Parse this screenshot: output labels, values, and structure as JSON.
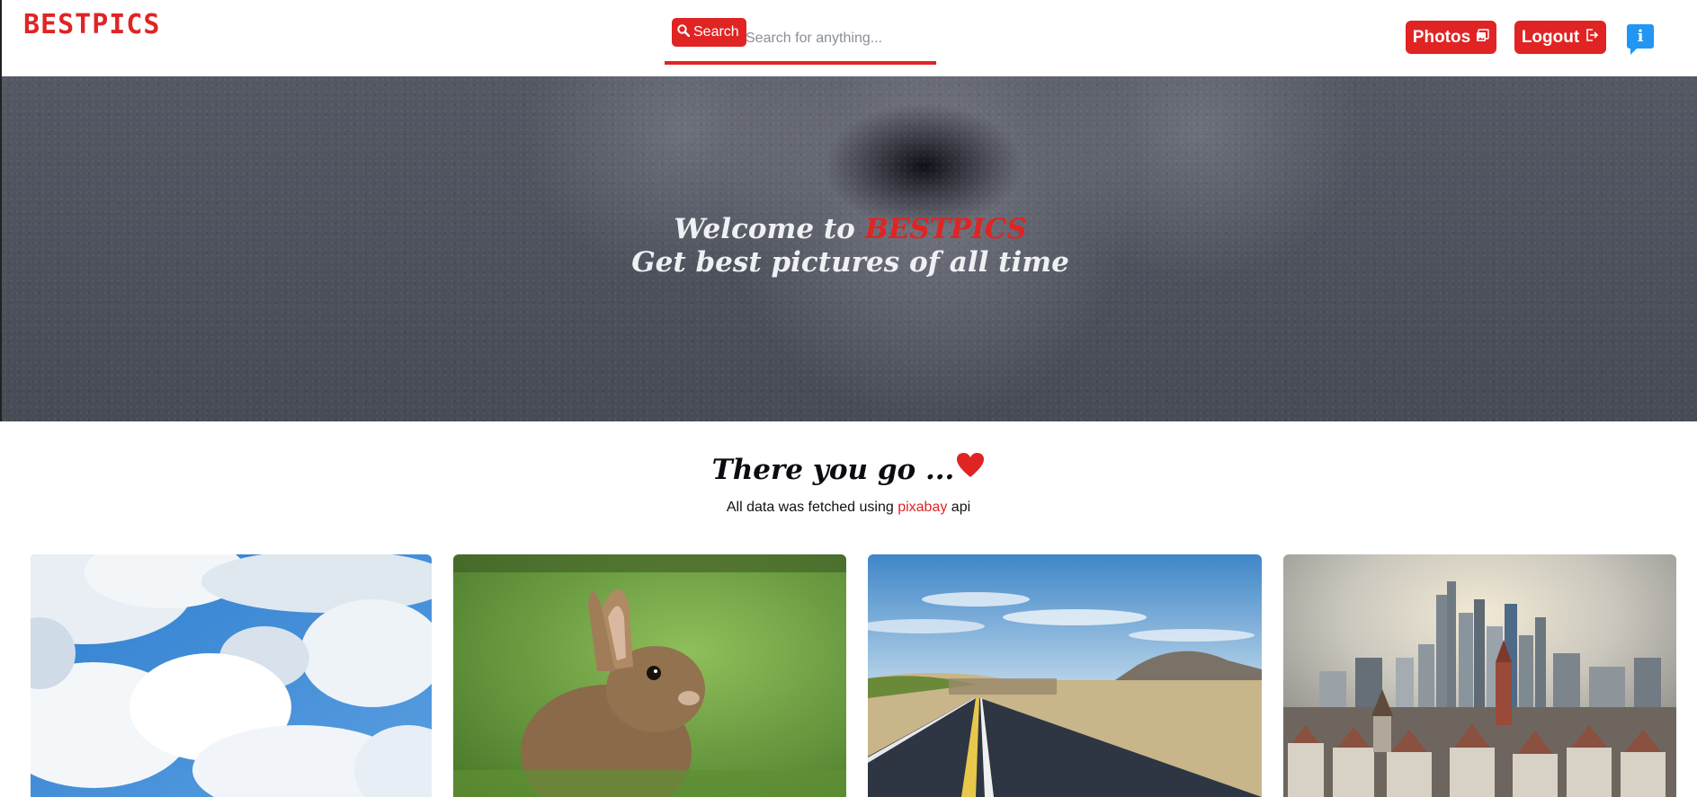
{
  "navbar": {
    "logo": "BESTPICS",
    "search": {
      "button_label": "Search",
      "placeholder": "Search for anything..."
    },
    "photos_label": "Photos",
    "logout_label": "Logout",
    "info_label": "i"
  },
  "hero": {
    "welcome_prefix": "Welcome to ",
    "brand": "BESTPICS",
    "subtitle": "Get best pictures of all time"
  },
  "section": {
    "title": "There you go ...",
    "subtitle_prefix": "All data was fetched using ",
    "link_text": "pixabay",
    "subtitle_suffix": " api"
  },
  "gallery": {
    "images": [
      {
        "icon": "sky-clouds"
      },
      {
        "icon": "rabbit"
      },
      {
        "icon": "road-landscape"
      },
      {
        "icon": "city-skyline"
      }
    ]
  },
  "colors": {
    "accent": "#e02424",
    "info": "#2196f3"
  }
}
